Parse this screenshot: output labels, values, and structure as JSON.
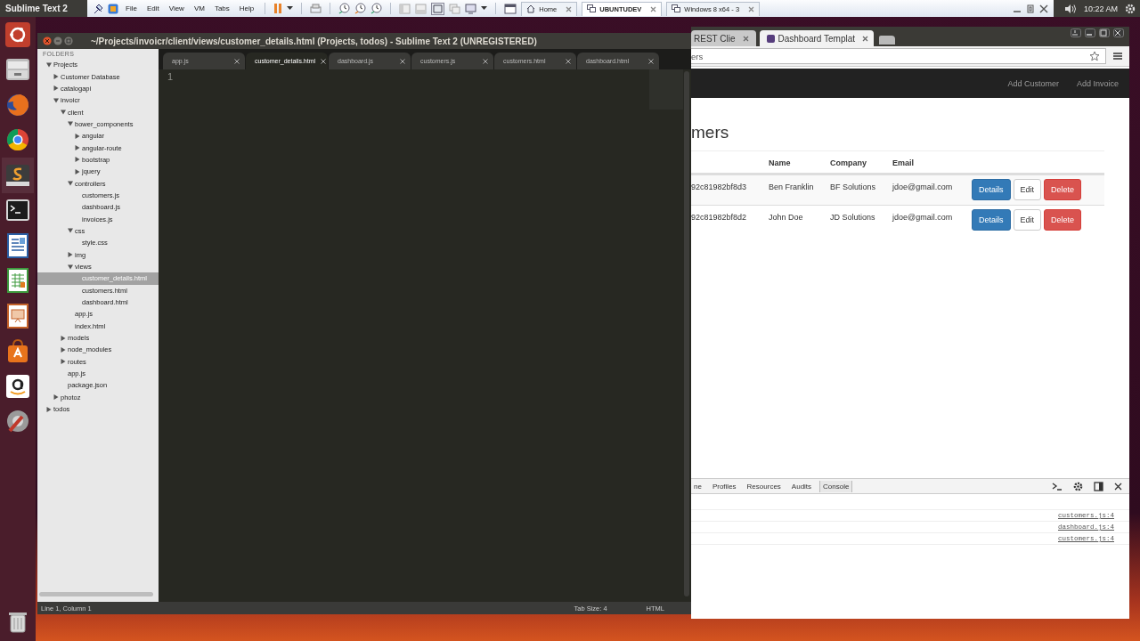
{
  "top_panel": {
    "app_name": "Sublime Text 2",
    "clock": "10:22 AM"
  },
  "vm_toolbar": {
    "menus": [
      "File",
      "Edit",
      "View",
      "VM",
      "Tabs",
      "Help"
    ],
    "tabs": [
      {
        "label": "Home",
        "selected": false
      },
      {
        "label": "UBUNTUDEV",
        "selected": true
      },
      {
        "label": "Windows 8 x64 - 3",
        "selected": false
      }
    ]
  },
  "sublime": {
    "title": "~/Projects/invoicr/client/views/customer_details.html (Projects, todos) - Sublime Text 2 (UNREGISTERED)",
    "sidebar_heading": "FOLDERS",
    "tree": [
      {
        "label": "Projects",
        "kind": "folder",
        "expanded": true,
        "selected": false,
        "children": [
          {
            "label": "Customer Database",
            "kind": "folder",
            "expanded": false,
            "selected": false
          },
          {
            "label": "catalogapi",
            "kind": "folder",
            "expanded": false,
            "selected": false
          },
          {
            "label": "invoicr",
            "kind": "folder",
            "expanded": true,
            "selected": false,
            "children": [
              {
                "label": "client",
                "kind": "folder",
                "expanded": true,
                "selected": false,
                "children": [
                  {
                    "label": "bower_components",
                    "kind": "folder",
                    "expanded": true,
                    "selected": false,
                    "children": [
                      {
                        "label": "angular",
                        "kind": "folder",
                        "expanded": false,
                        "selected": false
                      },
                      {
                        "label": "angular-route",
                        "kind": "folder",
                        "expanded": false,
                        "selected": false
                      },
                      {
                        "label": "bootstrap",
                        "kind": "folder",
                        "expanded": false,
                        "selected": false
                      },
                      {
                        "label": "jquery",
                        "kind": "folder",
                        "expanded": false,
                        "selected": false
                      }
                    ]
                  },
                  {
                    "label": "controllers",
                    "kind": "folder",
                    "expanded": true,
                    "selected": false,
                    "children": [
                      {
                        "label": "customers.js",
                        "kind": "file",
                        "selected": false
                      },
                      {
                        "label": "dashboard.js",
                        "kind": "file",
                        "selected": false
                      },
                      {
                        "label": "invoices.js",
                        "kind": "file",
                        "selected": false
                      }
                    ]
                  },
                  {
                    "label": "css",
                    "kind": "folder",
                    "expanded": true,
                    "selected": false,
                    "children": [
                      {
                        "label": "style.css",
                        "kind": "file",
                        "selected": false
                      }
                    ]
                  },
                  {
                    "label": "img",
                    "kind": "folder",
                    "expanded": false,
                    "selected": false
                  },
                  {
                    "label": "views",
                    "kind": "folder",
                    "expanded": true,
                    "selected": false,
                    "children": [
                      {
                        "label": "customer_details.html",
                        "kind": "file",
                        "selected": true
                      },
                      {
                        "label": "customers.html",
                        "kind": "file",
                        "selected": false
                      },
                      {
                        "label": "dashboard.html",
                        "kind": "file",
                        "selected": false
                      }
                    ]
                  },
                  {
                    "label": "app.js",
                    "kind": "file",
                    "selected": false
                  },
                  {
                    "label": "index.html",
                    "kind": "file",
                    "selected": false
                  }
                ]
              },
              {
                "label": "models",
                "kind": "folder",
                "expanded": false,
                "selected": false
              },
              {
                "label": "node_modules",
                "kind": "folder",
                "expanded": false,
                "selected": false
              },
              {
                "label": "routes",
                "kind": "folder",
                "expanded": false,
                "selected": false
              },
              {
                "label": "app.js",
                "kind": "file",
                "selected": false
              },
              {
                "label": "package.json",
                "kind": "file",
                "selected": false
              }
            ]
          },
          {
            "label": "photoz",
            "kind": "folder",
            "expanded": false,
            "selected": false
          }
        ]
      },
      {
        "label": "todos",
        "kind": "folder",
        "expanded": false,
        "selected": false
      }
    ],
    "tabs": [
      {
        "label": "app.js",
        "selected": false
      },
      {
        "label": "customer_details.html",
        "selected": true
      },
      {
        "label": "dashboard.js",
        "selected": false
      },
      {
        "label": "customers.js",
        "selected": false
      },
      {
        "label": "customers.html",
        "selected": false
      },
      {
        "label": "dashboard.html",
        "selected": false
      }
    ],
    "line_numbers": [
      "1"
    ],
    "status": {
      "position": "Line 1, Column 1",
      "tab_size": "Tab Size: 4",
      "syntax": "HTML"
    }
  },
  "browser": {
    "tabs": [
      {
        "label": "REST Clie",
        "selected": false
      },
      {
        "label": "Dashboard Templat",
        "selected": true
      }
    ],
    "address": "ers",
    "nav_links": [
      "Add Customer",
      "Add Invoice"
    ],
    "heading": "mers",
    "table": {
      "columns": [
        "Name",
        "Company",
        "Email"
      ],
      "rows": [
        {
          "id": "92c81982bf8d3",
          "name": "Ben Franklin",
          "company": "BF Solutions",
          "email": "jdoe@gmail.com",
          "actions": [
            {
              "label": "Details",
              "kind": "primary"
            },
            {
              "label": "Edit",
              "kind": "default"
            },
            {
              "label": "Delete",
              "kind": "danger"
            }
          ]
        },
        {
          "id": "92c81982bf8d2",
          "name": "John Doe",
          "company": "JD Solutions",
          "email": "jdoe@gmail.com",
          "actions": [
            {
              "label": "Details",
              "kind": "primary"
            },
            {
              "label": "Edit",
              "kind": "default"
            },
            {
              "label": "Delete",
              "kind": "danger"
            }
          ]
        }
      ]
    },
    "devtools": {
      "tabs": [
        {
          "label": "ne",
          "selected": false
        },
        {
          "label": "Profiles",
          "selected": false
        },
        {
          "label": "Resources",
          "selected": false
        },
        {
          "label": "Audits",
          "selected": false
        },
        {
          "label": "Console",
          "selected": true
        }
      ],
      "console_sources": [
        "customers.js:4",
        "dashboard.js:4",
        "customers.js:4"
      ]
    }
  }
}
